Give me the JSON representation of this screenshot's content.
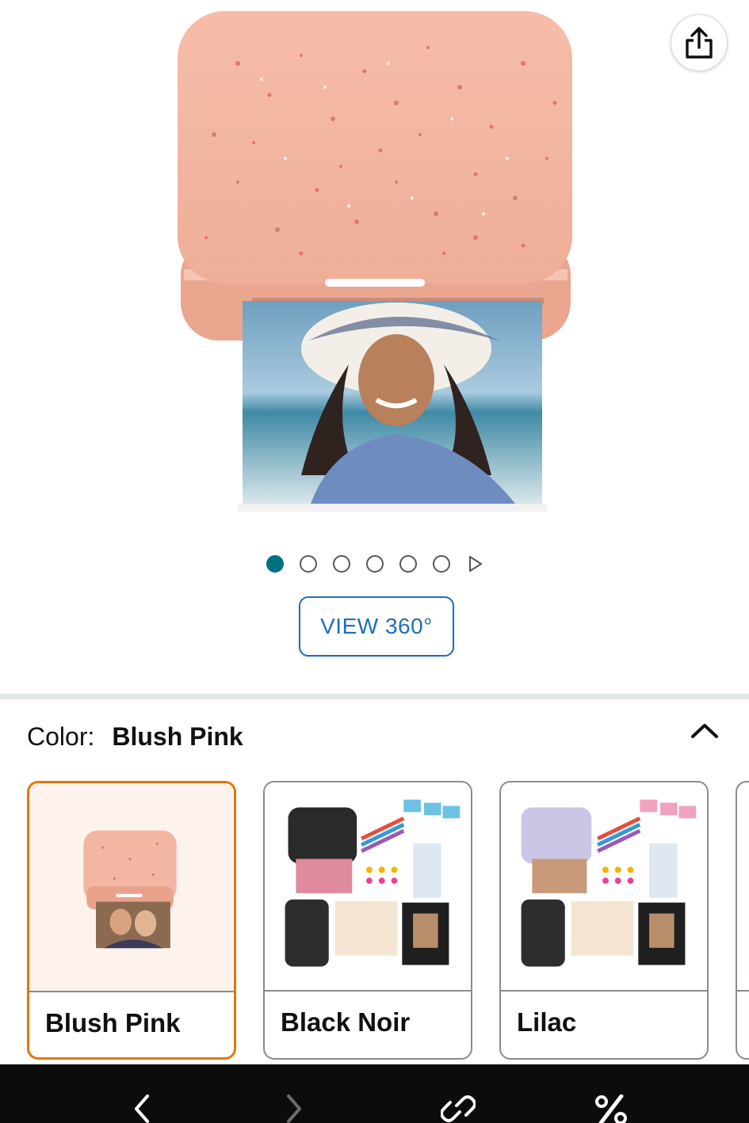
{
  "hero": {
    "share_icon": "share-icon",
    "image_desc_icon": "product-image"
  },
  "carousel": {
    "total_dots": 6,
    "active_index": 0,
    "next_icon": "play-next-icon"
  },
  "view360": {
    "label": "VIEW 360°"
  },
  "color_selector": {
    "label": "Color:",
    "selected_value": "Blush Pink",
    "collapse_icon": "chevron-up-icon",
    "options": [
      {
        "name": "Blush Pink",
        "selected": true
      },
      {
        "name": "Black Noir",
        "selected": false
      },
      {
        "name": "Lilac",
        "selected": false
      }
    ]
  },
  "bottom_bar": {
    "icons": [
      "back-icon",
      "forward-icon",
      "link-icon",
      "percent-icon"
    ]
  },
  "colors": {
    "accent_teal": "#007185",
    "link_blue": "#1f6fb8",
    "selected_orange": "#e77600",
    "printer_pink": "#f2b5a0"
  }
}
